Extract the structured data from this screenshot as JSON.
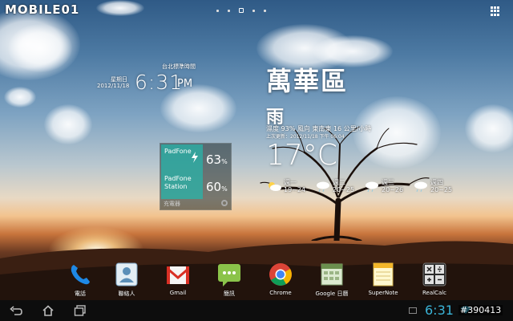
{
  "status_bar": {
    "logo_text": "MOBILE01"
  },
  "home_screen": {
    "page_count": 5,
    "active_page": 3
  },
  "clock_widget": {
    "timezone": "台北標準時間",
    "weekday": "星期日",
    "date": "2012/11/18",
    "time": "6:31",
    "ampm": "PM"
  },
  "weather_widget": {
    "city": "萬華區",
    "condition": "雨",
    "detail": "濕度 93% 風向 東南東 16 公里/小時",
    "updated": "上次更新：2012/11/18 下午 06:04",
    "temperature": "17°C",
    "forecast": [
      {
        "day": "週一",
        "range": "19~24",
        "icon": "partly-cloudy-icon"
      },
      {
        "day": "週二",
        "range": "20~25",
        "icon": "cloud-rain-icon"
      },
      {
        "day": "週三",
        "range": "20~26",
        "icon": "cloud-rain-icon"
      },
      {
        "day": "週四",
        "range": "20~25",
        "icon": "cloud-rain-icon"
      }
    ]
  },
  "battery_widget": {
    "rows": [
      {
        "name_line1": "PadFone",
        "name_line2": "",
        "percent": "63",
        "unit": "%"
      },
      {
        "name_line1": "PadFone",
        "name_line2": "Station",
        "percent": "60",
        "unit": "%"
      }
    ],
    "footer": "充電器",
    "accent_color": "#28b4aa"
  },
  "dock": {
    "apps": [
      {
        "label": "電話",
        "icon": "phone-icon"
      },
      {
        "label": "聯絡人",
        "icon": "contacts-icon"
      },
      {
        "label": "Gmail",
        "icon": "gmail-icon"
      },
      {
        "label": "簡訊",
        "icon": "messaging-icon"
      },
      {
        "label": "Chrome",
        "icon": "chrome-icon"
      },
      {
        "label": "Google 日曆",
        "icon": "calendar-icon"
      },
      {
        "label": "SuperNote",
        "icon": "supernote-icon"
      },
      {
        "label": "RealCalc",
        "icon": "calculator-icon"
      }
    ]
  },
  "nav_bar": {
    "status_time": "6:31",
    "watermark": "#390413",
    "accent_color": "#3ab4d8"
  }
}
